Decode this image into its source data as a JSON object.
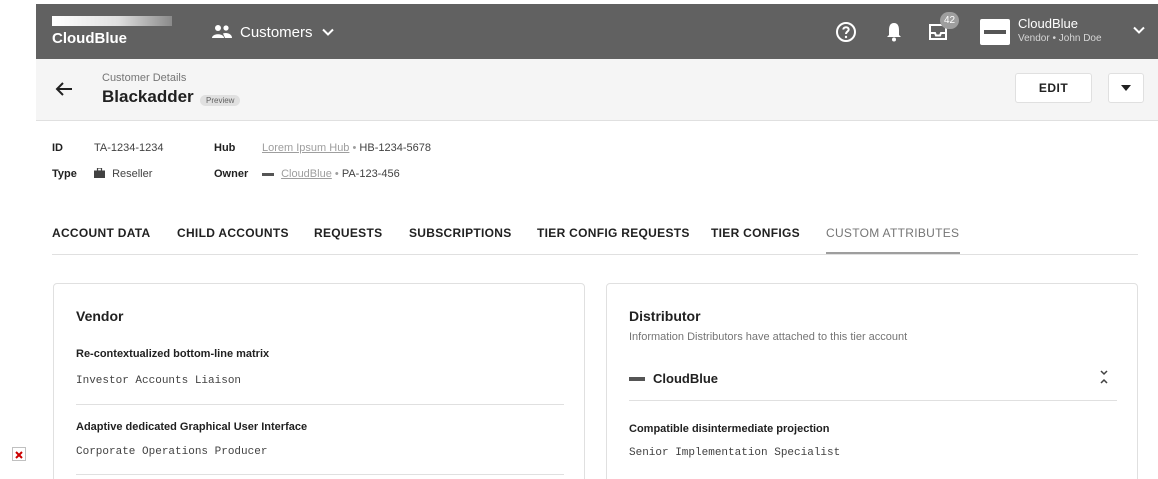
{
  "topbar": {
    "logo_text": "CloudBlue",
    "nav_label": "Customers",
    "notifications_badge": "42",
    "account_name": "CloudBlue",
    "account_sub": "Vendor • John Doe",
    "icons": [
      "people-icon",
      "chevron-down-icon",
      "help-icon",
      "bell-icon",
      "inbox-icon",
      "chevron-down-icon"
    ]
  },
  "subheader": {
    "breadcrumb": "Customer Details",
    "title": "Blackadder",
    "chip": "Preview",
    "edit_label": "EDIT"
  },
  "meta": {
    "id_label": "ID",
    "id_value": "TA-1234-1234",
    "hub_label": "Hub",
    "hub_link": "Lorem Ipsum Hub",
    "hub_id": "HB-1234-5678",
    "type_label": "Type",
    "type_value": "Reseller",
    "owner_label": "Owner",
    "owner_link": "CloudBlue",
    "owner_id": "PA-123-456",
    "separator": "•"
  },
  "tabs": [
    {
      "label": "ACCOUNT DATA"
    },
    {
      "label": "CHILD ACCOUNTS"
    },
    {
      "label": "REQUESTS"
    },
    {
      "label": "SUBSCRIPTIONS"
    },
    {
      "label": "TIER CONFIG REQUESTS"
    },
    {
      "label": "TIER CONFIGS"
    },
    {
      "label": "CUSTOM ATTRIBUTES",
      "active": true
    }
  ],
  "vendor_card": {
    "title": "Vendor",
    "attributes": [
      {
        "name": "Re-contextualized bottom-line matrix",
        "value": "Investor Accounts Liaison"
      },
      {
        "name": "Adaptive dedicated Graphical User Interface",
        "value": "Corporate Operations Producer"
      }
    ]
  },
  "distributor_card": {
    "title": "Distributor",
    "description": "Information Distributors have attached to this tier account",
    "distributor_name": "CloudBlue",
    "attributes": [
      {
        "name": "Compatible disintermediate projection",
        "value": "Senior Implementation Specialist"
      }
    ]
  },
  "colors": {
    "topbar": "#616161",
    "subheader": "#f5f5f5",
    "border": "#e0e0e0",
    "broken_image_mark": "#cc0000"
  }
}
